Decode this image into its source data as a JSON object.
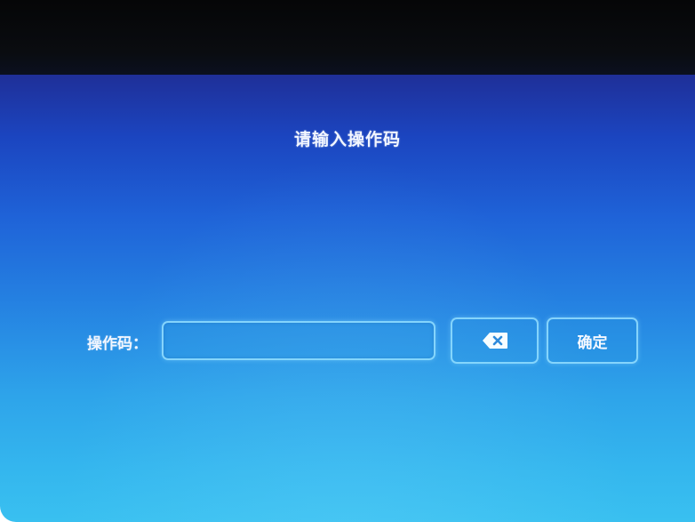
{
  "screen": {
    "title": "请输入操作码"
  },
  "form": {
    "label": "操作码：",
    "input_value": "",
    "input_placeholder": ""
  },
  "buttons": {
    "backspace_icon": "backspace-icon",
    "confirm_label": "确定"
  },
  "colors": {
    "background_top": "#1f2f98",
    "background_bottom": "#39c0f0",
    "bezel": "#050607",
    "control_border": "#96e1ff",
    "text": "#f2f6ff"
  }
}
